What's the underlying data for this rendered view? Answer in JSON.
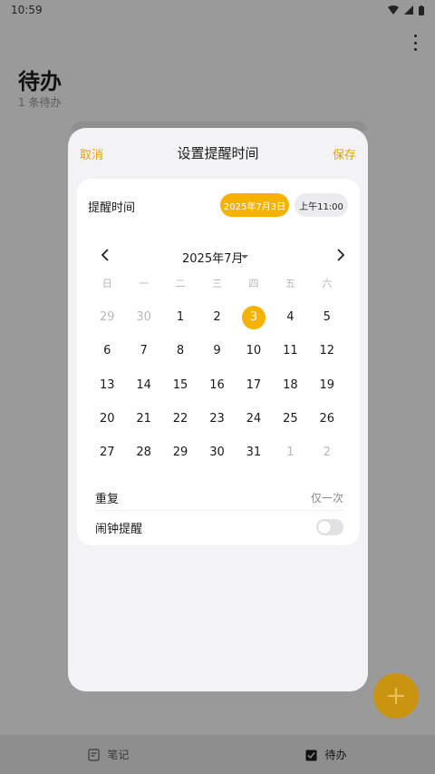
{
  "status": {
    "time": "10:59"
  },
  "app": {
    "title": "待办",
    "subtitle": "1 条待办"
  },
  "sheet": {
    "cancel": "取消",
    "title": "设置提醒时间",
    "save": "保存",
    "reminder_label": "提醒时间",
    "date_chip": "2025年7月3日",
    "time_chip": "上午11:00",
    "month": "2025年7月",
    "weekdays": [
      "日",
      "一",
      "二",
      "三",
      "四",
      "五",
      "六"
    ],
    "days": [
      {
        "d": "29",
        "muted": true
      },
      {
        "d": "30",
        "muted": true
      },
      {
        "d": "1"
      },
      {
        "d": "2"
      },
      {
        "d": "3",
        "selected": true
      },
      {
        "d": "4"
      },
      {
        "d": "5"
      },
      {
        "d": "6"
      },
      {
        "d": "7"
      },
      {
        "d": "8"
      },
      {
        "d": "9"
      },
      {
        "d": "10"
      },
      {
        "d": "11"
      },
      {
        "d": "12"
      },
      {
        "d": "13"
      },
      {
        "d": "14"
      },
      {
        "d": "15"
      },
      {
        "d": "16"
      },
      {
        "d": "17"
      },
      {
        "d": "18"
      },
      {
        "d": "19"
      },
      {
        "d": "20"
      },
      {
        "d": "21"
      },
      {
        "d": "22"
      },
      {
        "d": "23"
      },
      {
        "d": "24"
      },
      {
        "d": "25"
      },
      {
        "d": "26"
      },
      {
        "d": "27"
      },
      {
        "d": "28"
      },
      {
        "d": "29"
      },
      {
        "d": "30"
      },
      {
        "d": "31"
      },
      {
        "d": "1",
        "muted": true
      },
      {
        "d": "2",
        "muted": true
      }
    ],
    "repeat_label": "重复",
    "repeat_value": "仅一次",
    "alarm_label": "闹钟提醒",
    "alarm_on": false
  },
  "nav": {
    "notes": "笔记",
    "todo": "待办"
  },
  "colors": {
    "accent": "#f5b300",
    "accent_text": "#e0a30f",
    "fab": "#c99510"
  }
}
